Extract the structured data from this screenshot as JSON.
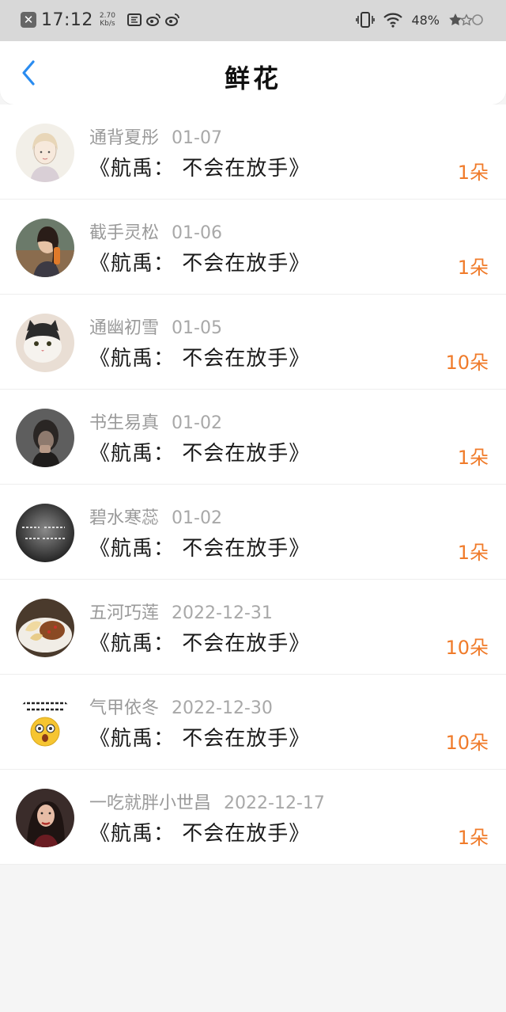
{
  "status_bar": {
    "time": "17:12",
    "speed_value": "2.70",
    "speed_unit": "Kb/s",
    "battery": "48%"
  },
  "header": {
    "title": "鲜花",
    "back_icon": "chevron-left-icon",
    "accent": "#2a8cf0"
  },
  "colors": {
    "count": "#f07b2a",
    "name": "#9a9a9a",
    "gift": "#1a1a1a"
  },
  "records": [
    {
      "name": "通背夏彤",
      "date": "01-07",
      "gift": "《航禹： 不会在放手》",
      "count": "1朵",
      "avatar": "avatar-girl-drawing"
    },
    {
      "name": "截手灵松",
      "date": "01-06",
      "gift": "《航禹： 不会在放手》",
      "count": "1朵",
      "avatar": "avatar-woman-selfie"
    },
    {
      "name": "通幽初雪",
      "date": "01-05",
      "gift": "《航禹： 不会在放手》",
      "count": "10朵",
      "avatar": "avatar-cat"
    },
    {
      "name": "书生易真",
      "date": "01-02",
      "gift": "《航禹： 不会在放手》",
      "count": "1朵",
      "avatar": "avatar-dark-portrait"
    },
    {
      "name": "碧水寒蕊",
      "date": "01-02",
      "gift": "《航禹： 不会在放手》",
      "count": "1朵",
      "avatar": "avatar-text-dark"
    },
    {
      "name": "五河巧莲",
      "date": "2022-12-31",
      "gift": "《航禹： 不会在放手》",
      "count": "10朵",
      "avatar": "avatar-food"
    },
    {
      "name": "气甲依冬",
      "date": "2022-12-30",
      "gift": "《航禹： 不会在放手》",
      "count": "10朵",
      "avatar": "avatar-emoji"
    },
    {
      "name": "一吃就胖小世昌",
      "date": "2022-12-17",
      "gift": "《航禹： 不会在放手》",
      "count": "1朵",
      "avatar": "avatar-woman-portrait"
    }
  ]
}
